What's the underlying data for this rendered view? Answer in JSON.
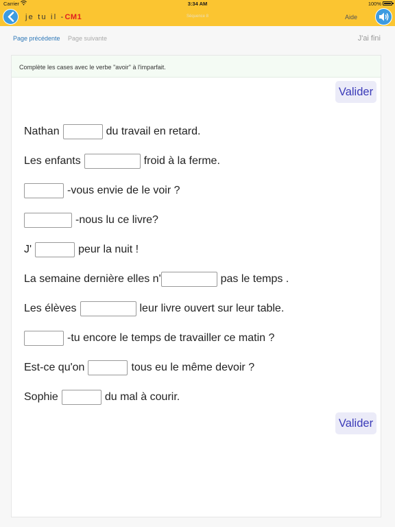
{
  "status_bar": {
    "carrier": "Carrier",
    "time": "3:34 AM",
    "battery": "100%"
  },
  "nav": {
    "title": "je tu il -",
    "level": "CM1",
    "center_label": "Séquence 8",
    "help": "Aide",
    "back_icon": "chevron-left-icon",
    "sound_icon": "speaker-icon"
  },
  "toolbar": {
    "prev": "Page précédente",
    "next": "Page suivante",
    "done": "J'ai fini"
  },
  "exercise": {
    "instruction": "Complète les cases avec le verbe \"avoir\" à l'imparfait.",
    "validate_label": "Valider",
    "sentences": [
      {
        "before": "Nathan",
        "after": "du travail en retard.",
        "value": ""
      },
      {
        "before": "Les enfants",
        "after": "froid à la ferme.",
        "value": ""
      },
      {
        "before": "",
        "after": "-vous envie de le voir ?",
        "value": ""
      },
      {
        "before": "",
        "after": "-nous lu ce livre?",
        "value": ""
      },
      {
        "before": "J'",
        "after": "peur la nuit !",
        "value": ""
      },
      {
        "before": "La semaine dernière elles n'",
        "after": "pas le temps .",
        "value": ""
      },
      {
        "before": "Les élèves",
        "after": "leur livre ouvert sur leur table.",
        "value": ""
      },
      {
        "before": "",
        "after": "-tu encore le temps de travailler ce matin ?",
        "value": ""
      },
      {
        "before": "Est-ce qu'on",
        "after": "tous eu le même devoir ?",
        "value": ""
      },
      {
        "before": "Sophie",
        "after": "du mal à courir.",
        "value": ""
      }
    ]
  }
}
